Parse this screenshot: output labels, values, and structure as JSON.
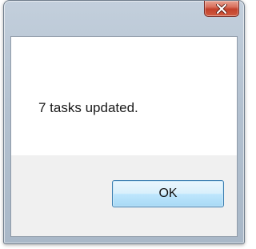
{
  "dialog": {
    "message": "7 tasks updated.",
    "ok_label": "OK",
    "close_icon": "close-icon"
  }
}
